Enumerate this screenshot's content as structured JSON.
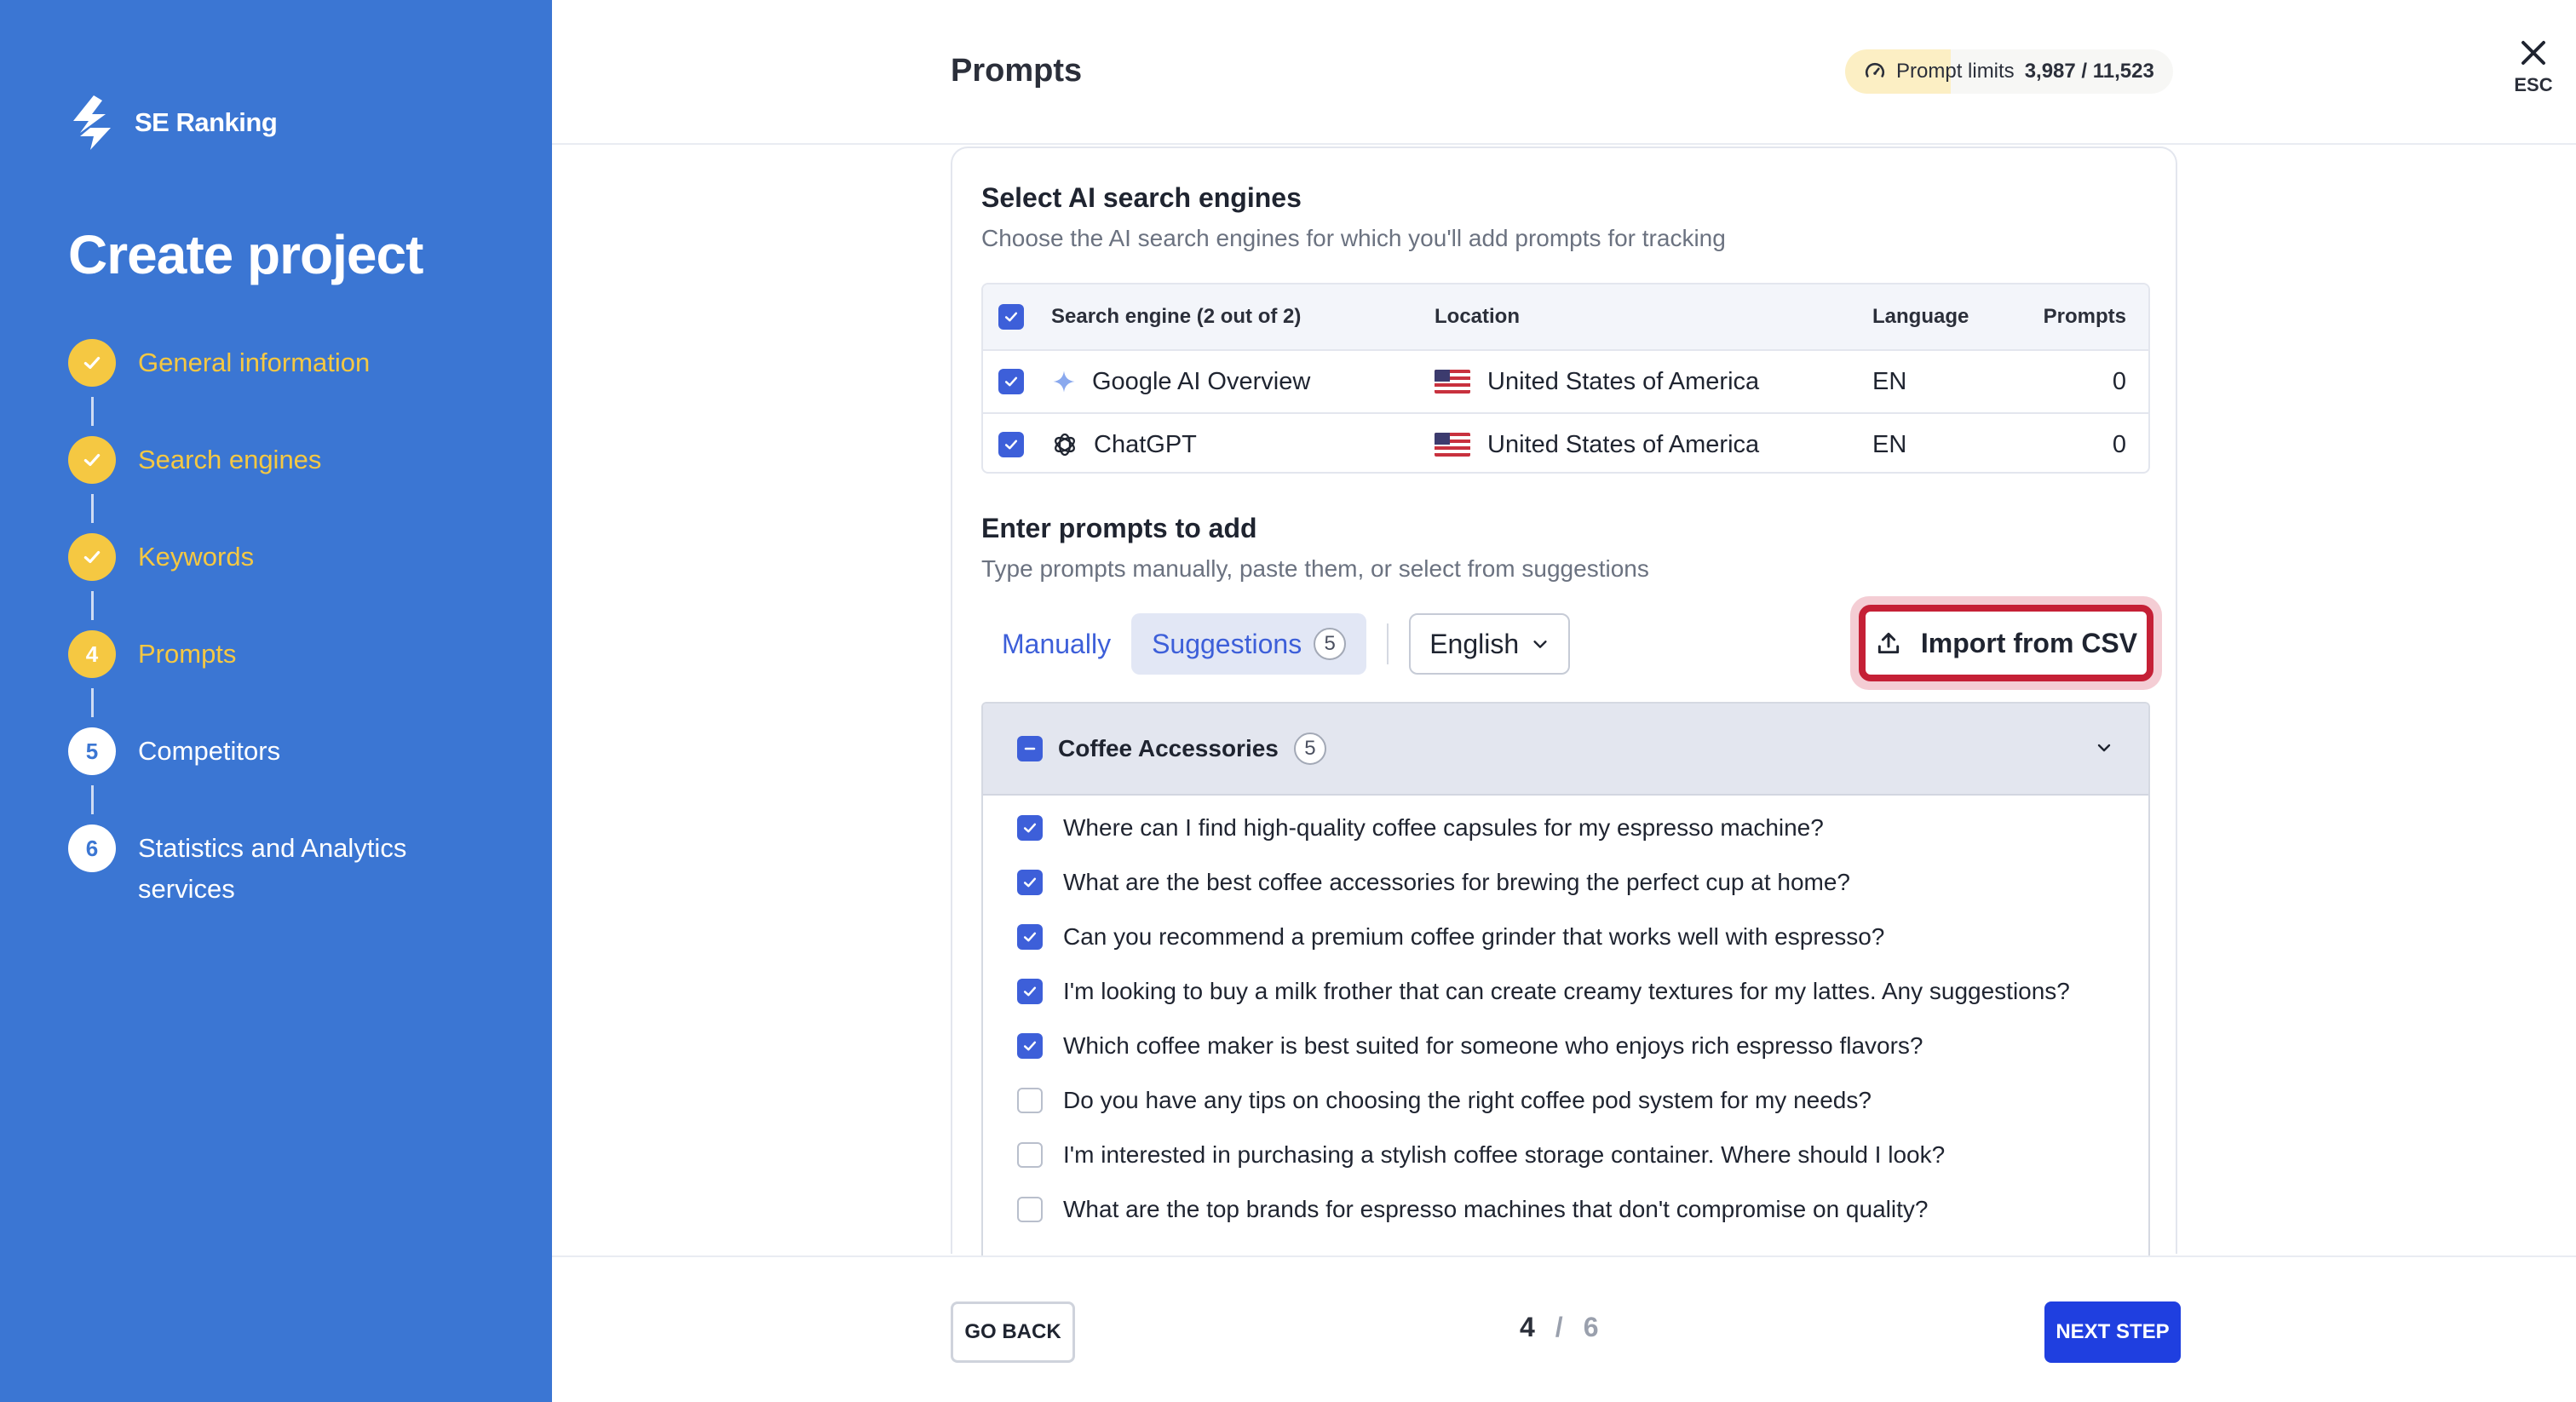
{
  "sidebar": {
    "brand": "SE Ranking",
    "title": "Create project",
    "steps": [
      {
        "label": "General information",
        "number": "",
        "state": "done"
      },
      {
        "label": "Search engines",
        "number": "",
        "state": "done"
      },
      {
        "label": "Keywords",
        "number": "",
        "state": "done"
      },
      {
        "label": "Prompts",
        "number": "4",
        "state": "current"
      },
      {
        "label": "Competitors",
        "number": "5",
        "state": "pending"
      },
      {
        "label": "Statistics and Analytics",
        "label2": "services",
        "number": "6",
        "state": "pending"
      }
    ]
  },
  "header": {
    "title": "Prompts",
    "limits_label": "Prompt limits",
    "limits_value": "3,987 / 11,523",
    "close_label": "ESC"
  },
  "engines": {
    "title": "Select AI search engines",
    "subtitle": "Choose the AI search engines for which you'll add prompts for tracking",
    "columns": {
      "engine": "Search engine (2 out of 2)",
      "location": "Location",
      "language": "Language",
      "prompts": "Prompts"
    },
    "rows": [
      {
        "name": "Google AI Overview",
        "location": "United States of America",
        "language": "EN",
        "prompts": "0",
        "checked": true,
        "icon": "sparkle-icon"
      },
      {
        "name": "ChatGPT",
        "location": "United States of America",
        "language": "EN",
        "prompts": "0",
        "checked": true,
        "icon": "chatgpt-icon"
      }
    ]
  },
  "prompts": {
    "title": "Enter prompts to add",
    "subtitle": "Type prompts manually, paste them, or select from suggestions",
    "tab_manual": "Manually",
    "tab_suggestions": "Suggestions",
    "suggestions_count": "5",
    "language": "English",
    "import_label": "Import from CSV",
    "group": {
      "title": "Coffee Accessories",
      "count": "5",
      "items": [
        {
          "text": "Where can I find high-quality coffee capsules for my espresso machine?",
          "checked": true
        },
        {
          "text": "What are the best coffee accessories for brewing the perfect cup at home?",
          "checked": true
        },
        {
          "text": "Can you recommend a premium coffee grinder that works well with espresso?",
          "checked": true
        },
        {
          "text": "I'm looking to buy a milk frother that can create creamy textures for my lattes. Any suggestions?",
          "checked": true
        },
        {
          "text": "Which coffee maker is best suited for someone who enjoys rich espresso flavors?",
          "checked": true
        },
        {
          "text": "Do you have any tips on choosing the right coffee pod system for my needs?",
          "checked": false
        },
        {
          "text": "I'm interested in purchasing a stylish coffee storage container. Where should I look?",
          "checked": false
        },
        {
          "text": "What are the top brands for espresso machines that don't compromise on quality?",
          "checked": false
        }
      ]
    }
  },
  "footer": {
    "back_label": "GO BACK",
    "current_step": "4",
    "separator": "/",
    "total_steps": "6",
    "next_label": "NEXT STEP"
  },
  "colors": {
    "sidebar_bg": "#3b76d3",
    "step_done": "#f5c842",
    "accent": "#3d5fd9",
    "primary_button": "#1f3fe0",
    "highlight_border": "#c52036"
  }
}
